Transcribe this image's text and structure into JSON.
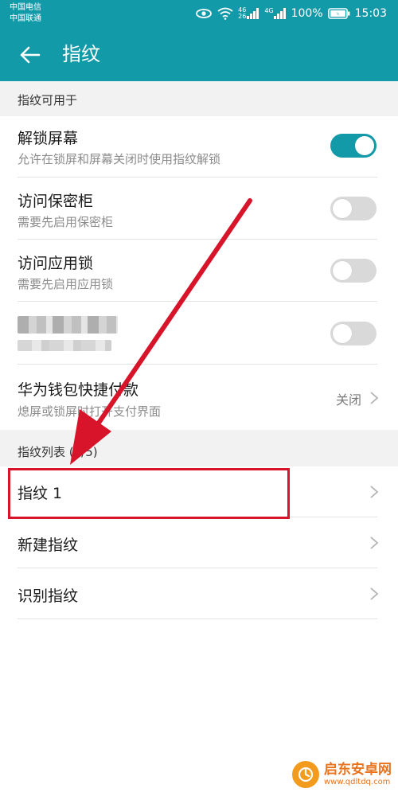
{
  "statusbar": {
    "carrier1": "中国电信",
    "carrier2": "中国联通",
    "signal_tag1": "46",
    "signal_tag2": "26",
    "signal_tag3": "4G",
    "battery_percent": "100%",
    "time": "15:03",
    "icons": [
      "eye-icon",
      "wifi-icon",
      "signal-icon",
      "signal-icon",
      "battery-icon"
    ]
  },
  "appbar": {
    "title": "指纹",
    "back_icon": "back-arrow-icon"
  },
  "section1": {
    "header": "指纹可用于"
  },
  "items": [
    {
      "title": "解锁屏幕",
      "subtitle": "允许在锁屏和屏幕关闭时使用指纹解锁",
      "toggle": true
    },
    {
      "title": "访问保密柜",
      "subtitle": "需要先启用保密柜",
      "toggle": false
    },
    {
      "title": "访问应用锁",
      "subtitle": "需要先启用应用锁",
      "toggle": false
    },
    {
      "title": "",
      "subtitle": "",
      "toggle": false,
      "blurred": true
    },
    {
      "title": "华为钱包快捷付款",
      "subtitle": "熄屏或锁屏时打开支付界面",
      "value": "关闭"
    }
  ],
  "section2": {
    "header": "指纹列表 (1/5)"
  },
  "fingerprints": [
    {
      "title": "指纹 1"
    },
    {
      "title": "新建指纹"
    },
    {
      "title": "识别指纹"
    }
  ],
  "annotation": {
    "color": "#d8142a"
  },
  "watermark": {
    "name": "启东安卓网",
    "url": "www.qdltdq.com",
    "icon": "logo-icon"
  },
  "colors": {
    "accent": "#139aa9",
    "annotation": "#d8142a"
  }
}
